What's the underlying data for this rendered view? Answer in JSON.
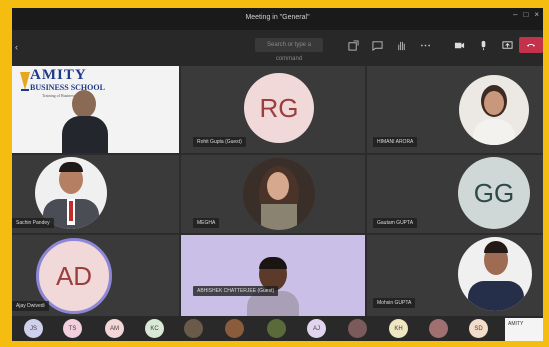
{
  "window": {
    "title": "Meeting in \"General\""
  },
  "toolbar": {
    "search_placeholder": "Search or type a command"
  },
  "tiles": [
    {
      "id": "amity",
      "logo_line1": "AMITY",
      "logo_line2": "BUSINESS SCHOOL",
      "logo_tag": "Training of Business Leaders",
      "logo_color": "#1f3a8a"
    },
    {
      "id": "rg",
      "initials": "RG",
      "name": "Rohit Gupta (Guest)",
      "bg": "#f1d9d9",
      "fg": "#9b3e3e"
    },
    {
      "id": "n1",
      "name": "HIMANI ARORA"
    },
    {
      "id": "n2",
      "name": "Sachin Pandey"
    },
    {
      "id": "n3",
      "name": "MEGHA"
    },
    {
      "id": "gg",
      "initials": "GG",
      "name": "Gautam GUPTA",
      "bg": "#cfd8d6",
      "fg": "#2e4a48"
    },
    {
      "id": "ad",
      "initials": "AD",
      "name": "Ajay Dwivedi",
      "bg": "#f1d9d9",
      "fg": "#9b3e3e"
    },
    {
      "id": "n4",
      "name": "ABHISHEK CHATTERJEE (Guest)"
    },
    {
      "id": "n5",
      "name": "Mohsin GUPTA"
    }
  ],
  "strip": [
    {
      "initials": "JS",
      "bg": "#cfd0ec"
    },
    {
      "initials": "TS",
      "bg": "#f2cfdc"
    },
    {
      "initials": "AM",
      "bg": "#f3d6d8"
    },
    {
      "initials": "KC",
      "bg": "#d8e9d5"
    },
    {
      "initials": "",
      "bg": "#6a5a4a"
    },
    {
      "initials": "",
      "bg": "#8a5c3c"
    },
    {
      "initials": "",
      "bg": "#5a6a3a"
    },
    {
      "initials": "AJ",
      "bg": "#e1d4ef"
    },
    {
      "initials": "",
      "bg": "#7a5a5a"
    },
    {
      "initials": "KH",
      "bg": "#efe6c2"
    },
    {
      "initials": "",
      "bg": "#a07070"
    },
    {
      "initials": "SD",
      "bg": "#f3dcc9"
    }
  ],
  "strip_card": {
    "text": "AMITY"
  },
  "colors": {
    "frame": "#f5bd10",
    "leave": "#c4314b",
    "tile": "#3b3a3a"
  }
}
